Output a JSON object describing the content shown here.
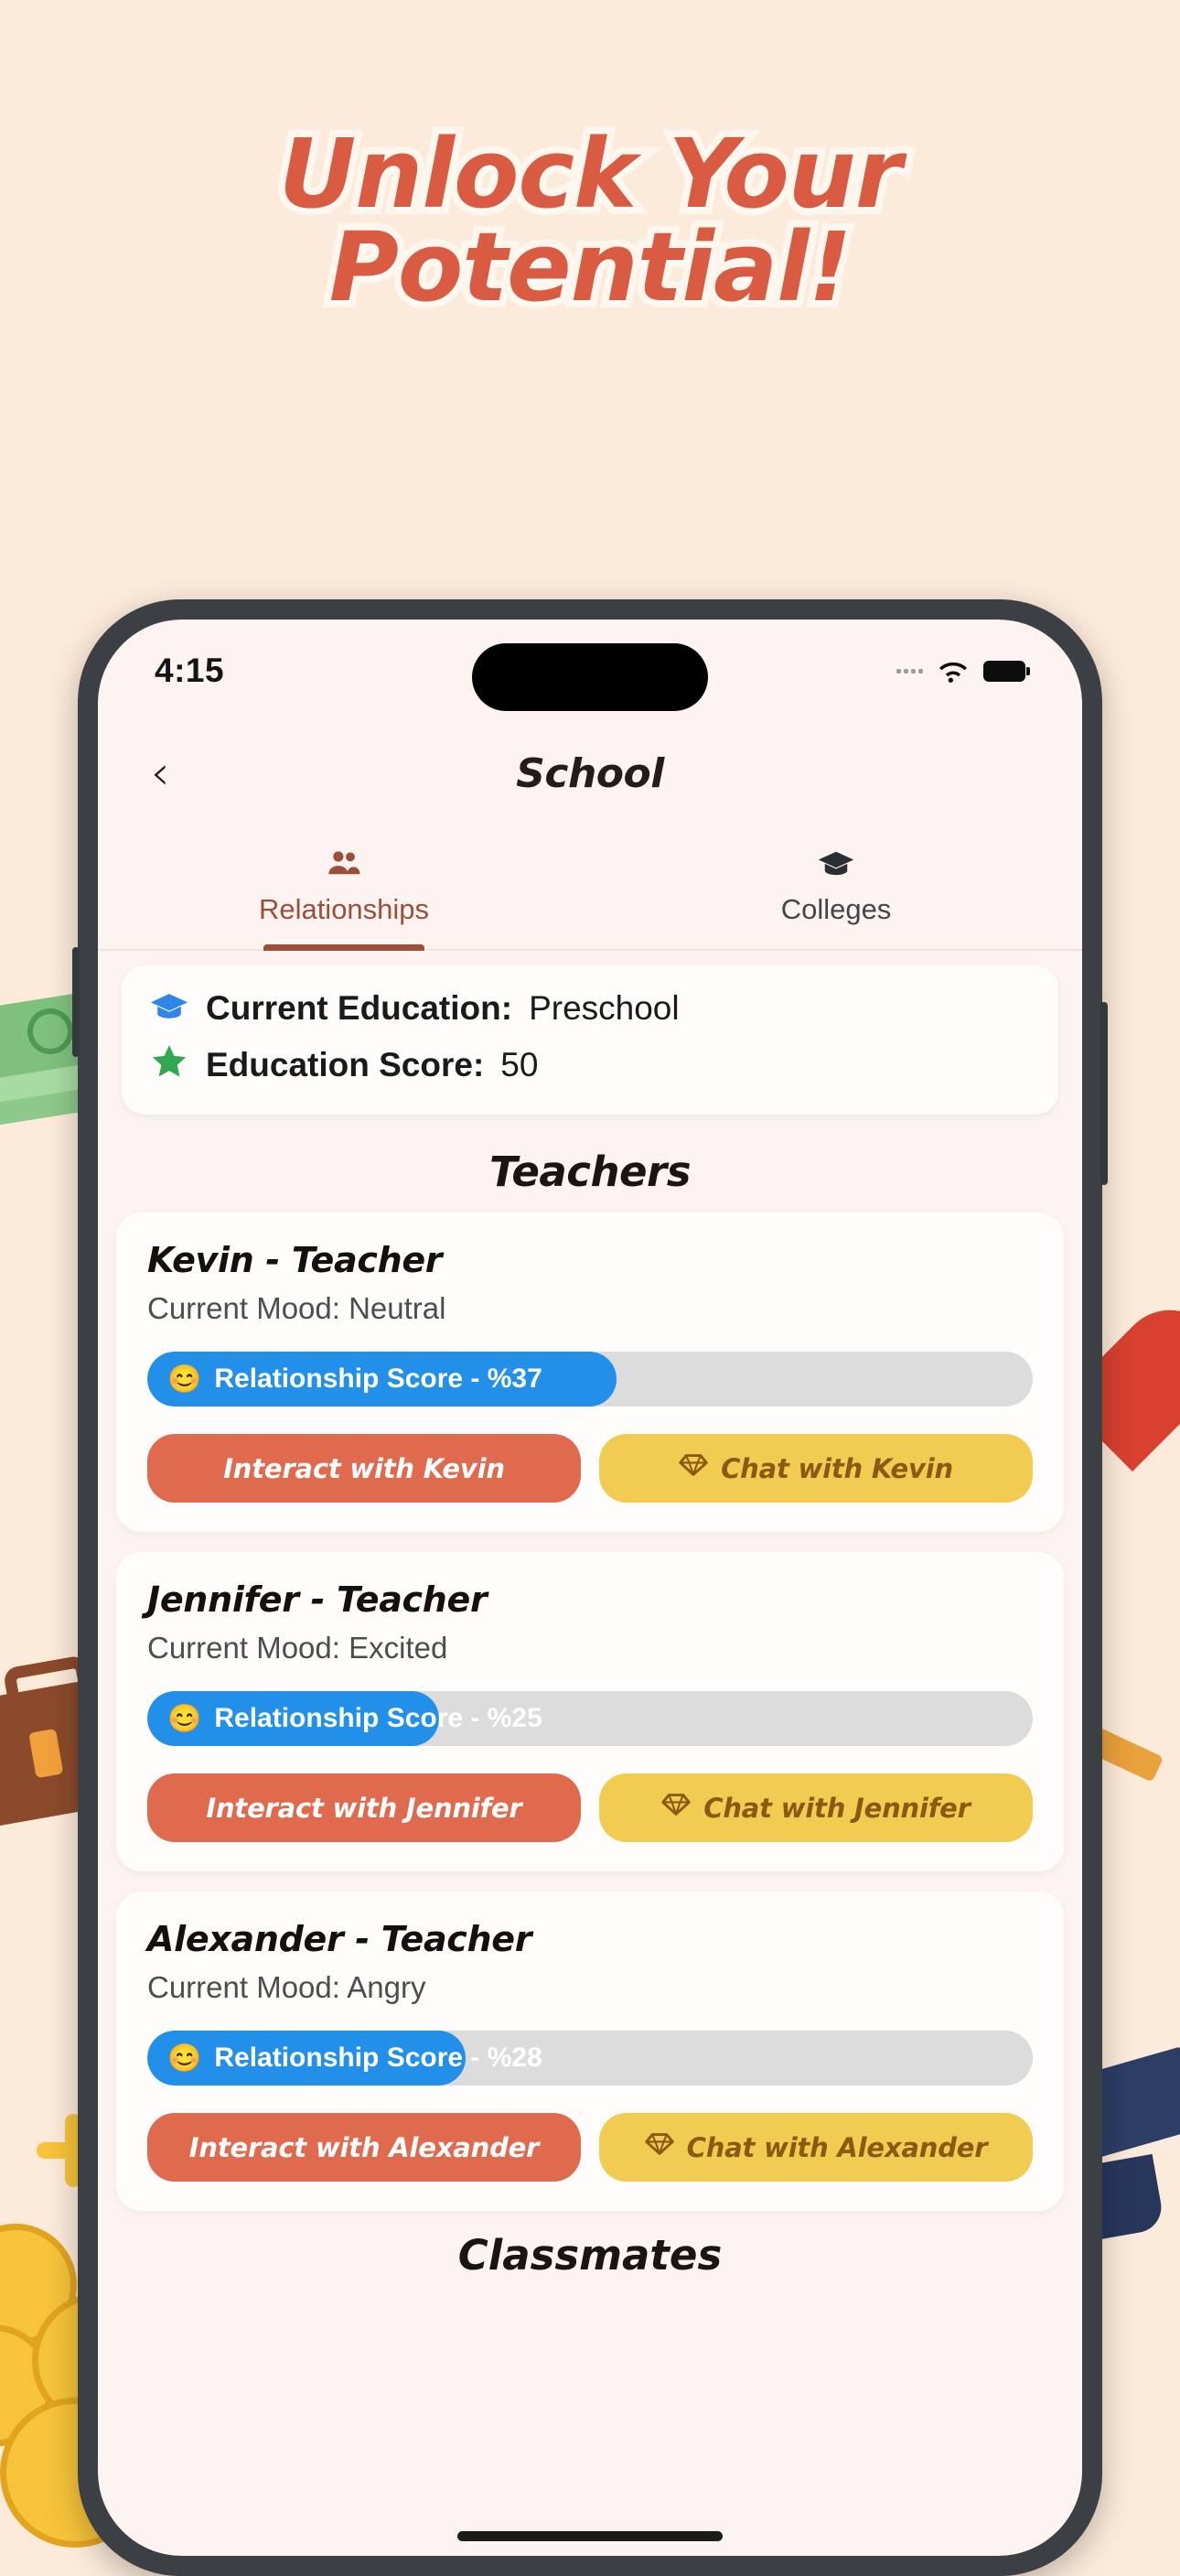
{
  "promo": {
    "headline_line1": "Unlock Your",
    "headline_line2": "Potential!",
    "background_color": "#FCEADA",
    "accent_color": "#D85B42"
  },
  "status_bar": {
    "time": "4:15",
    "signal_icon": "cellular-signal-icon",
    "wifi_icon": "wifi-icon",
    "battery_icon": "battery-icon"
  },
  "nav": {
    "back_icon": "chevron-left-icon",
    "title": "School"
  },
  "tabs": [
    {
      "label": "Relationships",
      "icon": "people-icon",
      "active": true
    },
    {
      "label": "Colleges",
      "icon": "graduation-cap-icon",
      "active": false
    }
  ],
  "education": {
    "current_education_label": "Current Education:",
    "current_education_value": "Preschool",
    "education_score_label": "Education Score:",
    "education_score_value": "50",
    "cap_icon": "graduation-cap-icon",
    "star_icon": "star-icon",
    "cap_color": "#2F86E8",
    "star_color": "#2FA84F"
  },
  "teachers_section_title": "Teachers",
  "classmates_section_title": "Classmates",
  "teachers": [
    {
      "name": "Kevin - Teacher",
      "mood": "Current Mood: Neutral",
      "score_label": "Relationship Score - %37",
      "score_percent": 37,
      "emoji": "😊",
      "interact_label": "Interact with Kevin",
      "chat_label": "Chat with Kevin",
      "chat_icon": "gem-icon"
    },
    {
      "name": "Jennifer - Teacher",
      "mood": "Current Mood: Excited",
      "score_label": "Relationship Score - %25",
      "score_percent": 25,
      "emoji": "😊",
      "interact_label": "Interact with Jennifer",
      "chat_label": "Chat with Jennifer",
      "chat_icon": "gem-icon"
    },
    {
      "name": "Alexander - Teacher",
      "mood": "Current Mood: Angry",
      "score_label": "Relationship Score - %28",
      "score_percent": 28,
      "emoji": "😊",
      "interact_label": "Interact with Alexander",
      "chat_label": "Chat with Alexander",
      "chat_icon": "gem-icon"
    }
  ],
  "colors": {
    "progress_fill": "#2290E8",
    "progress_track": "#DCDCDC",
    "interact_button": "#E06A4E",
    "chat_button": "#F2CB51",
    "tab_active": "#9C4F38"
  }
}
